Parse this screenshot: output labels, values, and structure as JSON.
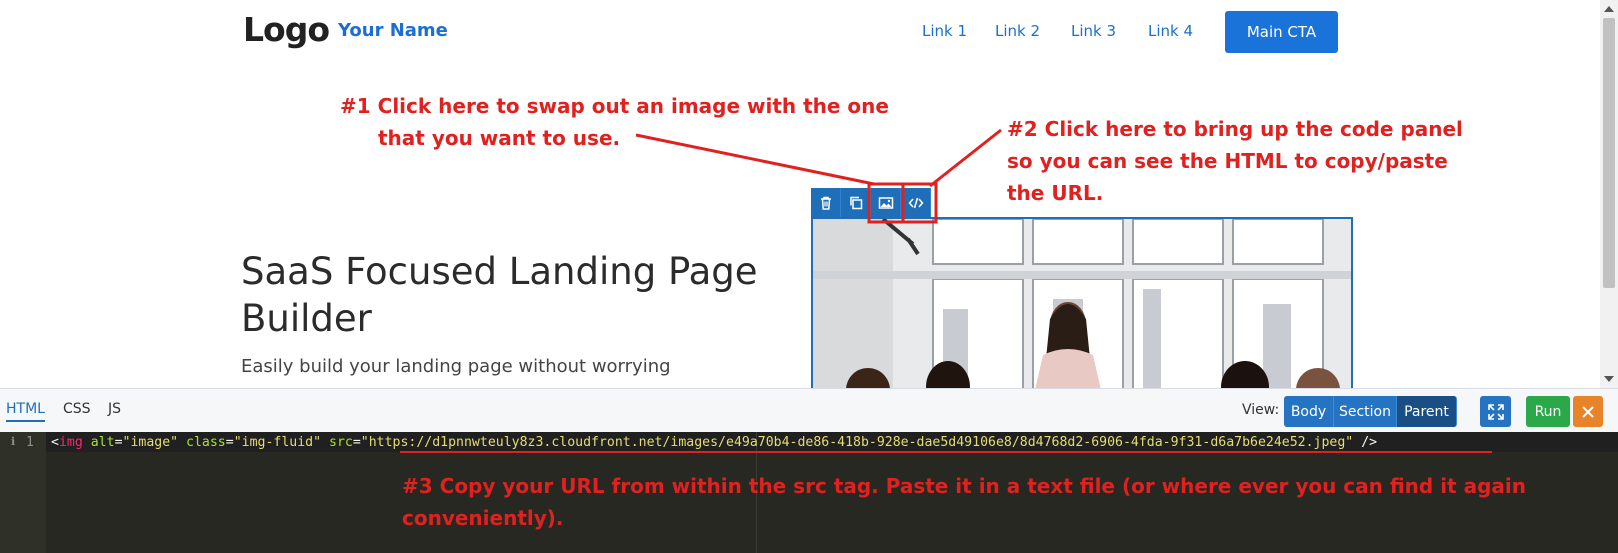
{
  "header": {
    "logo": "Logo",
    "your_name": "Your Name",
    "nav": [
      "Link 1",
      "Link 2",
      "Link 3",
      "Link 4"
    ],
    "cta": "Main CTA"
  },
  "hero": {
    "title": "SaaS Focused Landing Page Builder",
    "subtitle": "Easily build your landing page without worrying"
  },
  "annotations": {
    "step1_line1": "#1  Click here to swap out an image with the one",
    "step1_line2": "that you want to use.",
    "step2_line1": "#2  Click here to bring up the code panel",
    "step2_line2": "so you can see the HTML to copy/paste",
    "step2_line3": "the URL.",
    "step3_line1": "#3  Copy your URL from within the src tag. Paste it in a text file (or where ever you can find it again",
    "step3_line2": "conveniently)."
  },
  "editor": {
    "tabs": [
      "HTML",
      "CSS",
      "JS"
    ],
    "view_label": "View:",
    "view_options": [
      "Body",
      "Section",
      "Parent"
    ],
    "run": "Run",
    "line_number": "1",
    "code": {
      "open": "<",
      "tag": "img",
      "attr1": "alt",
      "val1": "\"image\"",
      "attr2": "class",
      "val2": "\"img-fluid\"",
      "attr3": "src",
      "val3": "\"https://d1pnnwteuly8z3.cloudfront.net/images/e49a70b4-de86-418b-928e-dae5d49106e8/8d4768d2-6906-4fda-9f31-d6a7b6e24e52.jpeg\"",
      "close": "/>"
    }
  },
  "colors": {
    "accent": "#1a73d9",
    "annotation": "#e0211f",
    "run": "#2ba84a",
    "close": "#e8832a"
  }
}
